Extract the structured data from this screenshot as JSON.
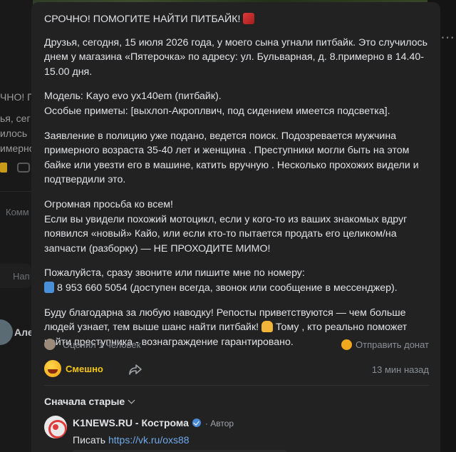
{
  "post": {
    "title": "СРОЧНО! ПОМОГИТЕ НАЙТИ ПИТБАЙК!",
    "para1": "Друзья, сегодня, 15 июля 2026 года, у моего сына угнали питбайк. Это случилось днем у магазина «Пятерочка» по адресу: ул. Бульварная, д. 8.примерно в 14.40-15.00 дня.",
    "para2": "Модель: Kayo evo yx140em (питбайк).\nОсобые приметы: [выхлоп-Акроплвич, под сидением имеется подсветка].",
    "para3": "Заявление в полицию уже подано, ведется поиск. Подозревается мужчина примерного возраста 35-40 лет и женщина . Преступники могли быть на этом байке или увезти его в машине, катить вручную . Несколько прохожих видели и подтвердили это.",
    "para4": "Огромная просьба ко всем!\nЕсли вы увидели похожий мотоцикл, если у кого-то из ваших знакомых вдруг появился «новый» Кайо, или если кто-то пытается продать его целиком/на запчасти (разборку) — НЕ ПРОХОДИТЕ МИМО!",
    "para5_line1": "Пожалуйста, сразу звоните или пишите мне по номеру:",
    "para5_line2": "8 953 660 5054 (доступен всегда, звонок или сообщение в мессенджер).",
    "para6_part1": "Буду благодарна за любую наводку! Репосты приветствуются — чем больше людей узнает, тем выше шанс найти питбайк!",
    "para6_part2": " Тому , кто реально поможет найти преступника - вознаграждение гарантировано."
  },
  "meta": {
    "rated": "Оценил 1 человек",
    "donate": "Отправить донат",
    "reaction": "Смешно",
    "time": "13 мин назад"
  },
  "comments": {
    "sort_label": "Сначала старые",
    "first": {
      "author": "K1NEWS.RU - Кострома",
      "badge": "· Автор",
      "text_prefix": "Писать ",
      "link": "https://vk.ru/oxs88"
    }
  },
  "background": {
    "line1": "ЧНО! П",
    "line2": "ья, сег",
    "line3": "илось",
    "line4": "имерно",
    "comment_label": "Комм",
    "input_placeholder": "Нап",
    "author_short": "Але"
  },
  "colors": {
    "accent": "#f5c518",
    "link": "#71aaeb",
    "modal_bg": "#222222"
  },
  "icons": [
    "motorcycle-emoji-icon",
    "phone-emoji-icon",
    "pray-emoji-icon",
    "coin-icon",
    "laugh-icon",
    "share-icon",
    "chevron-down-icon",
    "verified-icon"
  ]
}
